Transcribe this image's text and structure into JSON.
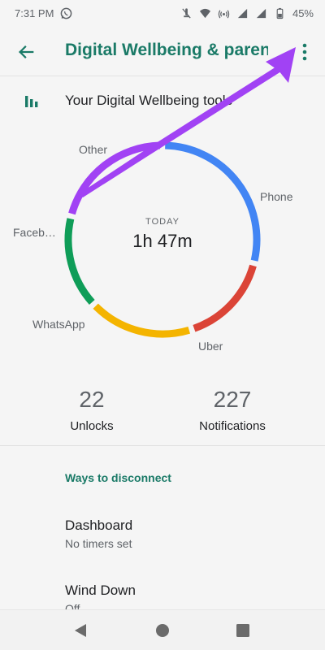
{
  "status": {
    "time": "7:31 PM",
    "battery": "45%",
    "icons": [
      "whatsapp-icon",
      "mute-icon",
      "wifi-icon",
      "hotspot-icon",
      "signal-icon",
      "signal-icon",
      "battery-icon"
    ]
  },
  "app_bar": {
    "title": "Digital Wellbeing & paren",
    "back_icon": "arrow-back-icon",
    "menu_icon": "more-vert-icon"
  },
  "tools": {
    "label": "Your Digital Wellbeing tools",
    "icon": "bar-chart-icon"
  },
  "donut": {
    "center_label": "TODAY",
    "center_value": "1h 47m",
    "segments": [
      {
        "name": "Phone",
        "fraction": 0.29,
        "color": "#4285f4"
      },
      {
        "name": "Uber",
        "fraction": 0.16,
        "color": "#db4437"
      },
      {
        "name": "WhatsApp",
        "fraction": 0.18,
        "color": "#f4b400"
      },
      {
        "name": "Faceb…",
        "fraction": 0.16,
        "color": "#0f9d58"
      },
      {
        "name": "Other",
        "fraction": 0.21,
        "color": "#a142f4"
      }
    ]
  },
  "stats": {
    "unlocks_value": "22",
    "unlocks_label": "Unlocks",
    "notifications_value": "227",
    "notifications_label": "Notifications"
  },
  "section": {
    "title": "Ways to disconnect",
    "items": [
      {
        "title": "Dashboard",
        "subtitle": "No timers set"
      },
      {
        "title": "Wind Down",
        "subtitle": "Off"
      }
    ]
  },
  "annotation": {
    "arrow_color": "#a142f4"
  },
  "nav": {
    "back_icon": "nav-back-icon",
    "home_icon": "nav-home-icon",
    "recents_icon": "nav-recents-icon"
  }
}
